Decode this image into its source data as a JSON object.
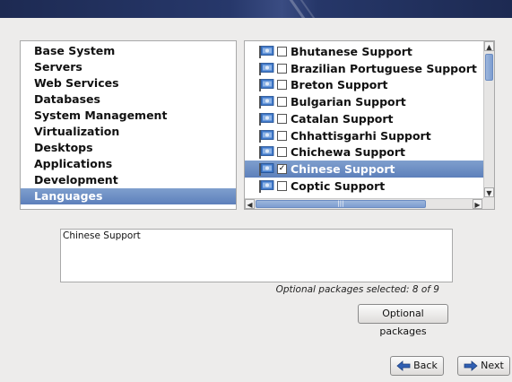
{
  "groups": {
    "items": [
      {
        "label": "Base System"
      },
      {
        "label": "Servers"
      },
      {
        "label": "Web Services"
      },
      {
        "label": "Databases"
      },
      {
        "label": "System Management"
      },
      {
        "label": "Virtualization"
      },
      {
        "label": "Desktops"
      },
      {
        "label": "Applications"
      },
      {
        "label": "Development"
      },
      {
        "label": "Languages"
      }
    ],
    "selected": "Languages"
  },
  "packages": {
    "items": [
      {
        "label": "Bhutanese Support",
        "checked": false
      },
      {
        "label": "Brazilian Portuguese Support",
        "checked": false
      },
      {
        "label": "Breton Support",
        "checked": false
      },
      {
        "label": "Bulgarian Support",
        "checked": false
      },
      {
        "label": "Catalan Support",
        "checked": false
      },
      {
        "label": "Chhattisgarhi Support",
        "checked": false
      },
      {
        "label": "Chichewa Support",
        "checked": false
      },
      {
        "label": "Chinese Support",
        "checked": true
      },
      {
        "label": "Coptic Support",
        "checked": false
      }
    ],
    "selected": "Chinese Support",
    "check_mark": "✓",
    "icon": "flag-icon"
  },
  "description": {
    "text": "Chinese Support"
  },
  "optional_status": "Optional packages selected: 8 of 9",
  "buttons": {
    "optional_packages": "Optional packages",
    "back": "Back",
    "next": "Next"
  },
  "colors": {
    "selection": "#6a8cc4",
    "banner": "#1d2a52",
    "arrow_back": "#2f5fb3",
    "arrow_next": "#2f5fb3"
  }
}
